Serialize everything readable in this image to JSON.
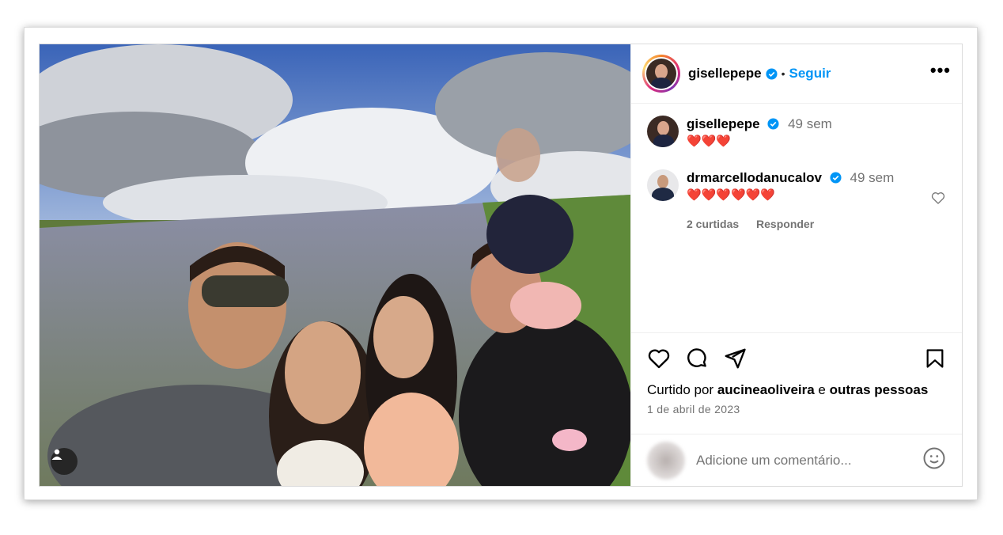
{
  "header": {
    "username": "gisellepepe",
    "separator": "•",
    "follow_label": "Seguir",
    "more_label": "•••"
  },
  "comments": [
    {
      "username": "gisellepepe",
      "time": "49 sem",
      "text": "❤️❤️❤️"
    },
    {
      "username": "drmarcellodanucalov",
      "time": "49 sem",
      "text": "❤️❤️❤️❤️❤️❤️",
      "likes": "2 curtidas",
      "reply_label": "Responder"
    }
  ],
  "likes": {
    "prefix": "Curtido por",
    "user": "aucineaoliveira",
    "connector": "e",
    "others": "outras pessoas"
  },
  "date": "1 de abril de 2023",
  "add_comment": {
    "placeholder": "Adicione um comentário..."
  },
  "colors": {
    "accent": "#0095f6",
    "verified": "#0095f6",
    "heart": "#e0222d"
  }
}
